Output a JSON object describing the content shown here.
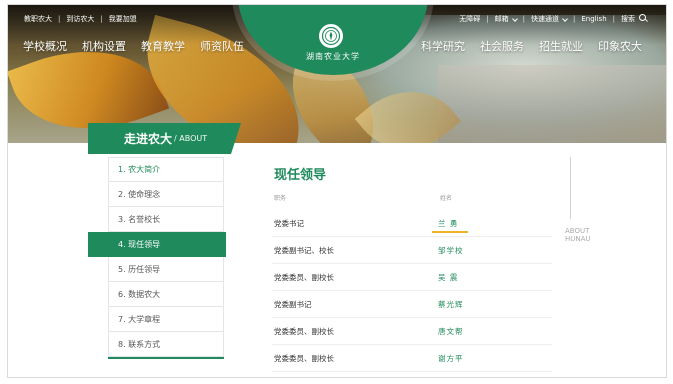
{
  "topbar": {
    "left_links": [
      "教职农大",
      "到访农大",
      "我要加盟"
    ],
    "right": {
      "accessibility": "无障碍",
      "mail": "邮箱",
      "quick_access": "快速通道",
      "language": "English",
      "search": "搜索"
    }
  },
  "logo": {
    "name": "湖南农业大学"
  },
  "nav": {
    "left": [
      "学校概况",
      "机构设置",
      "教育教学",
      "师资队伍"
    ],
    "right": [
      "科学研究",
      "社会服务",
      "招生就业",
      "印象农大"
    ]
  },
  "section_tab": {
    "title": "走进农大",
    "subtitle": "/ ABOUT"
  },
  "sidebar": {
    "items": [
      {
        "label": "1. 农大简介"
      },
      {
        "label": "2. 使命理念"
      },
      {
        "label": "3. 名誉校长"
      },
      {
        "label": "4. 现任领导"
      },
      {
        "label": "5. 历任领导"
      },
      {
        "label": "6. 数据农大"
      },
      {
        "label": "7. 大学章程"
      },
      {
        "label": "8. 联系方式"
      }
    ],
    "active_index": 3
  },
  "main": {
    "title": "现任领导",
    "col_position": "职务",
    "col_name": "姓名",
    "rows": [
      {
        "position": "党委书记",
        "name": "兰 勇"
      },
      {
        "position": "党委副书记、校长",
        "name": "邹学校"
      },
      {
        "position": "党委委员、副校长",
        "name": "吴 震"
      },
      {
        "position": "党委副书记",
        "name": "蔡光辉"
      },
      {
        "position": "党委委员、副校长",
        "name": "唐文帮"
      },
      {
        "position": "党委委员、副校长",
        "name": "谢方平"
      }
    ]
  },
  "side_vertical": {
    "text": "ABOUT HUNAU"
  },
  "colors": {
    "brand_green": "#1f8a5b",
    "accent_yellow": "#f0b429"
  },
  "icons": {
    "search": "search-icon",
    "dropdown": "chevron-down-icon",
    "logo": "university-emblem-icon"
  }
}
